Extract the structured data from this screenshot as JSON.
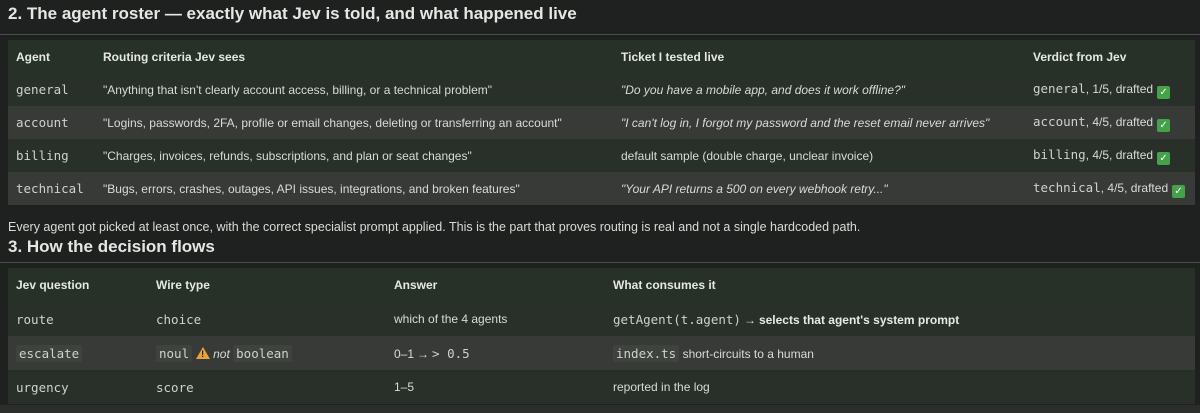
{
  "roster": {
    "heading": "2. The agent roster — exactly what Jev is told, and what happened live",
    "columns": [
      "Agent",
      "Routing criteria Jev sees",
      "Ticket I tested live",
      "Verdict from Jev"
    ],
    "rows": [
      {
        "agent": "general",
        "criteria": "\"Anything that isn't clearly account access, billing, or a technical problem\"",
        "ticket": "\"Do you have a mobile app, and does it work offline?\"",
        "ticket_italic": true,
        "verdict_agent": "general",
        "verdict_rest": ", 1/5, drafted"
      },
      {
        "agent": "account",
        "criteria": "\"Logins, passwords, 2FA, profile or email changes, deleting or transferring an account\"",
        "ticket": "\"I can't log in, I forgot my password and the reset email never arrives\"",
        "ticket_italic": true,
        "verdict_agent": "account",
        "verdict_rest": ", 4/5, drafted"
      },
      {
        "agent": "billing",
        "criteria": "\"Charges, invoices, refunds, subscriptions, and plan or seat changes\"",
        "ticket": "default sample (double charge, unclear invoice)",
        "ticket_italic": false,
        "verdict_agent": "billing",
        "verdict_rest": ", 4/5, drafted"
      },
      {
        "agent": "technical",
        "criteria": "\"Bugs, errors, crashes, outages, API issues, integrations, and broken features\"",
        "ticket": "\"Your API returns a 500 on every webhook retry...\"",
        "ticket_italic": true,
        "verdict_agent": "technical",
        "verdict_rest": ", 4/5, drafted"
      }
    ],
    "note": "Every agent got picked at least once, with the correct specialist prompt applied. This is the part that proves routing is real and not a single hardcoded path."
  },
  "flow": {
    "heading": "3. How the decision flows",
    "columns": [
      "Jev question",
      "Wire type",
      "Answer",
      "What consumes it"
    ],
    "rows": [
      {
        "question": "route",
        "wire": "choice",
        "answer": "which of the 4 agents",
        "consumer_code": "getAgent(t.agent)",
        "consumer_arrow": "→",
        "consumer_text": "selects that agent's system prompt"
      },
      {
        "question": "escalate",
        "wire_code": "noul",
        "wire_not": "not",
        "wire_type": "boolean",
        "answer_prefix": "0–1",
        "answer_arrow": "→",
        "answer_code": "> 0.5",
        "consumer_code": "index.ts",
        "consumer_text": "short-circuits to a human"
      },
      {
        "question": "urgency",
        "wire": "score",
        "answer": "1–5",
        "consumer_text": "reported in the log"
      }
    ]
  },
  "icons": {
    "check": "check-mark-icon",
    "warning": "warning-triangle-icon"
  },
  "colors": {
    "check_green": "#45a24a",
    "warning_orange": "#e8a33a"
  }
}
